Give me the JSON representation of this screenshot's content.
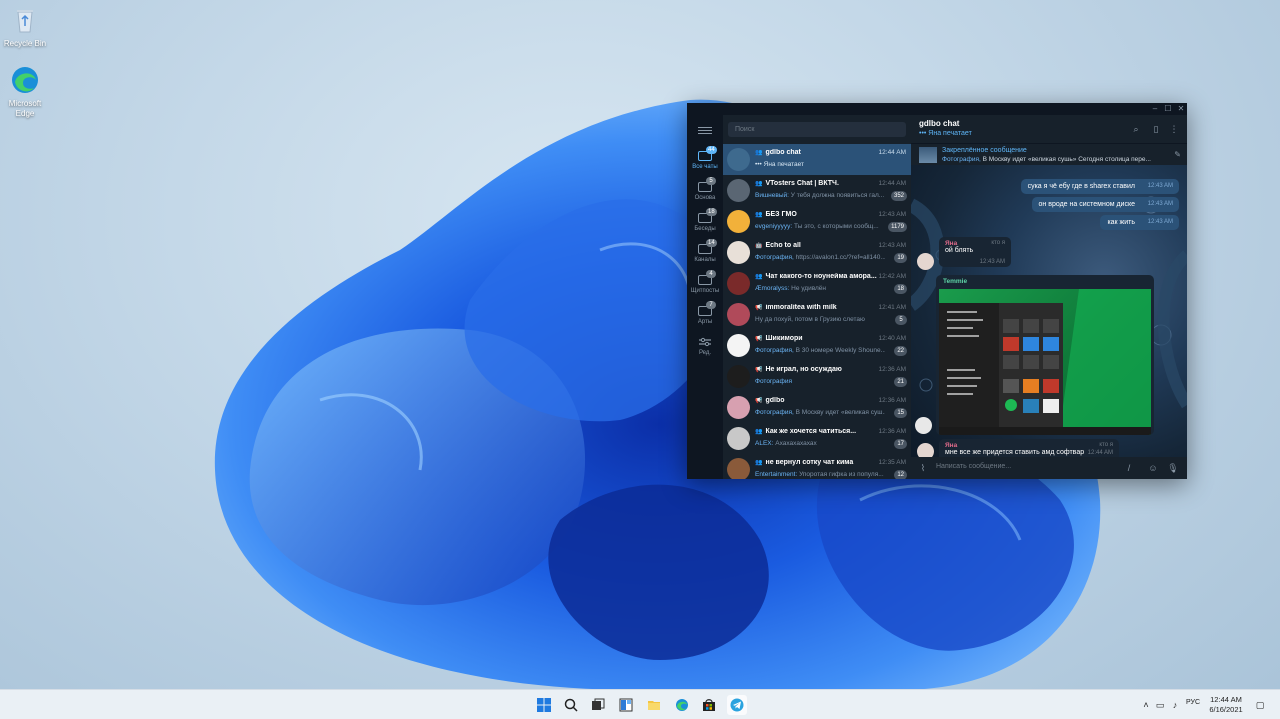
{
  "desktop": {
    "icons": [
      {
        "label": "Recycle Bin",
        "icon": "recycle-bin-icon"
      },
      {
        "label": "Microsoft Edge",
        "icon": "edge-icon"
      }
    ]
  },
  "telegram": {
    "window_controls": {
      "minimize": "–",
      "maximize": "☐",
      "close": "✕"
    },
    "folders": [
      {
        "label": "Все чаты",
        "badge": "44",
        "active": true
      },
      {
        "label": "Основа",
        "badge": "5"
      },
      {
        "label": "Беседы",
        "badge": "18"
      },
      {
        "label": "Каналы",
        "badge": "14"
      },
      {
        "label": "Щитпосты",
        "badge": "4"
      },
      {
        "label": "Арты",
        "badge": "7"
      },
      {
        "label": "Ред.",
        "badge": ""
      }
    ],
    "search_placeholder": "Поиск",
    "chats": [
      {
        "name": "gdlbo chat",
        "kind": "group",
        "time": "12:44 AM",
        "prefix": "",
        "message": "••• Яна печатает",
        "count": "",
        "active": true,
        "avatar": "#3e6a8e"
      },
      {
        "name": "VTosters Chat | ВКТЧ.",
        "kind": "group",
        "time": "12:44 AM",
        "prefix": "Вишневый: ",
        "message": "У тебя должна появиться гал...",
        "count": "352",
        "avatar": "#5a6673"
      },
      {
        "name": "БЕЗ ГМО",
        "kind": "group",
        "time": "12:43 AM",
        "prefix": "evgeniyyyyy: ",
        "message": "Ты это, с которыми сообщ...",
        "count": "1179",
        "avatar": "#f2b13a"
      },
      {
        "name": "Echo to all",
        "kind": "bot",
        "time": "12:43 AM",
        "prefix": "Фотография, ",
        "message": "https://avalon1.cc/?ref=all140...",
        "count": "19",
        "avatar": "#e8e0d8"
      },
      {
        "name": "Чат какого-то ноунейма амора...",
        "kind": "group",
        "time": "12:42 AM",
        "prefix": "Æmoralyss: ",
        "message": "Не удивлён",
        "count": "18",
        "avatar": "#7a2a2a"
      },
      {
        "name": "immoralitea with milk",
        "kind": "channel",
        "time": "12:41 AM",
        "prefix": "",
        "message": "Ну да похуй, потом в Грузию слетаю",
        "count": "5",
        "avatar": "#b04a5a"
      },
      {
        "name": "Шикимори",
        "kind": "channel",
        "time": "12:40 AM",
        "prefix": "Фотография, ",
        "message": "В 30 номере Weekly Shoune...",
        "count": "22",
        "avatar": "#f4f4f4"
      },
      {
        "name": "Не играл, но осуждаю",
        "kind": "channel",
        "time": "12:36 AM",
        "prefix": "Фотография",
        "message": "",
        "count": "21",
        "avatar": "#1d1d1d"
      },
      {
        "name": "gdlbo",
        "kind": "channel",
        "time": "12:36 AM",
        "prefix": "Фотография, ",
        "message": "В Москву идет «великая суш...",
        "count": "15",
        "avatar": "#d7a0b0"
      },
      {
        "name": "Как же хочется чатиться...",
        "kind": "group",
        "time": "12:36 AM",
        "prefix": "ALEX: ",
        "message": "Ахахахахахах",
        "count": "17",
        "avatar": "#c8c8c8"
      },
      {
        "name": "не вернул сотку чат кима",
        "kind": "group",
        "time": "12:35 AM",
        "prefix": "Entertainment: ",
        "message": "Упоротая гифка из популя...",
        "count": "12",
        "avatar": "#8a5a3a"
      }
    ],
    "header": {
      "title": "gdlbo chat",
      "status": "••• Яна печатает"
    },
    "pinned": {
      "title": "Закреплённое сообщение",
      "prefix": "Фотография, ",
      "text": "В Москву идет «великая сушь» Сегодня столица пере..."
    },
    "messages": [
      {
        "dir": "out",
        "text": "сука я чё ебу где в sharex ставил",
        "time": "12:43 AM"
      },
      {
        "dir": "out",
        "text": "он вроде на системном диске",
        "time": "12:43 AM"
      },
      {
        "dir": "out",
        "text": "как жить",
        "time": "12:43 AM"
      },
      {
        "dir": "in",
        "sender": "Яна",
        "role": "кто я",
        "text": "ой блять",
        "time": "12:43 AM"
      },
      {
        "dir": "in",
        "sender": "Temmie",
        "text": "",
        "time": ""
      },
      {
        "dir": "in",
        "sender": "Яна",
        "role": "кто я",
        "text": "мне все же придется ставить амд софтвар",
        "time": "12:44 AM"
      }
    ],
    "composer_placeholder": "Написать сообщение..."
  },
  "taskbar": {
    "apps": [
      "start-icon",
      "search-icon",
      "task-view-icon",
      "widgets-icon",
      "file-explorer-icon",
      "edge-icon",
      "store-icon",
      "telegram-icon"
    ],
    "language": "РУС",
    "time": "12:44 AM",
    "date": "6/16/2021"
  }
}
